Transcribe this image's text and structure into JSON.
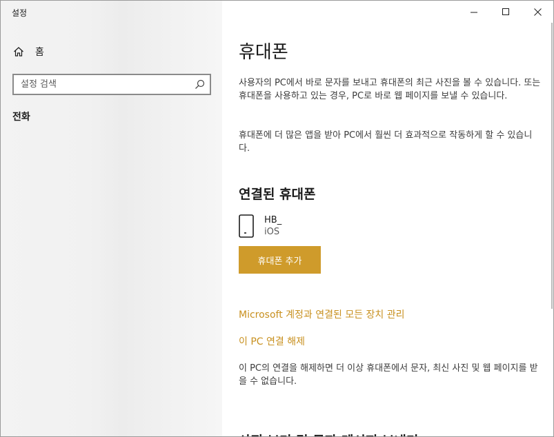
{
  "window": {
    "title": "설정",
    "minimize_icon": "minimize-icon",
    "maximize_icon": "maximize-icon",
    "close_icon": "close-icon"
  },
  "sidebar": {
    "home_label": "홈",
    "search_placeholder": "설정 검색",
    "section_label": "전화"
  },
  "main": {
    "title": "휴대폰",
    "intro_1": "사용자의 PC에서 바로 문자를 보내고 휴대폰의 최근 사진을 볼 수 있습니다. 또는 휴대폰을 사용하고 있는 경우, PC로 바로 웹 페이지를 보낼 수 있습니다.",
    "intro_2": "휴대폰에 더 많은 앱을 받아 PC에서 훨씬 더 효과적으로 작동하게 할 수 있습니다.",
    "connected_title": "연결된 휴대폰",
    "device": {
      "name": "HB_",
      "os": "iOS"
    },
    "add_phone_button": "휴대폰 추가",
    "manage_link": "Microsoft 계정과 연결된 모든 장치 관리",
    "unlink_link": "이 PC 연결 해제",
    "unlink_desc": "이 PC의 연결을 해제하면 더 이상 휴대폰에서 문자, 최신 사진 및 웹 페이지를 받을 수 없습니다.",
    "next_section_title": "사진 보기 및 문자 메시지 보내기"
  },
  "colors": {
    "accent": "#cf9b2b",
    "link": "#c8901f"
  }
}
